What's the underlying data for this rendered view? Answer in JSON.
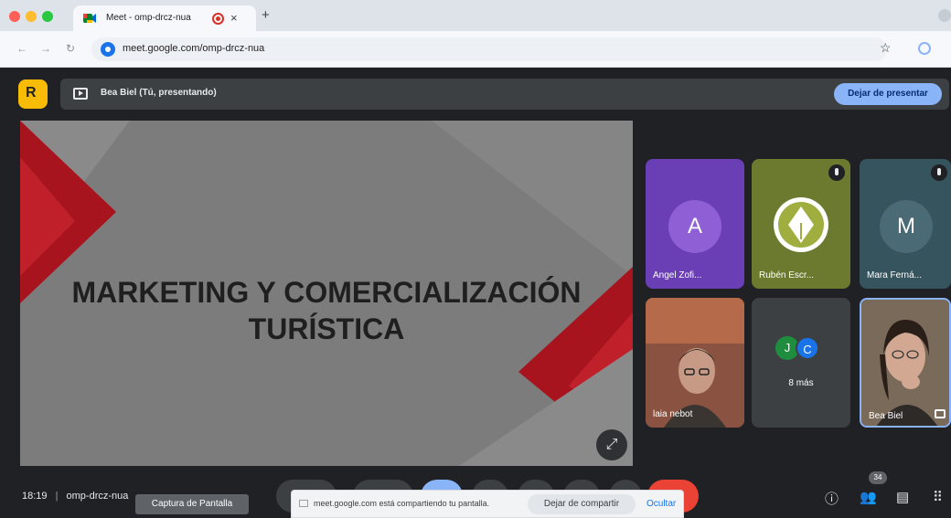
{
  "browser": {
    "tab_title": "Meet - omp-drcz-nua",
    "new_tab_symbol": "+",
    "close_symbol": "×",
    "url": "meet.google.com/omp-drcz-nua"
  },
  "meet": {
    "logo_letter": "R",
    "presenting_label": "Bea Biel (Tú, presentando)",
    "stop_presenting_label": "Dejar de presentar",
    "slide_title_line1": "MARKETING Y COMERCIALIZACIÓN",
    "slide_title_line2": "TURÍSTICA",
    "fullscreen_symbol": "⤢"
  },
  "participants": [
    {
      "name": "Angel Zofi...",
      "initial": "A"
    },
    {
      "name": "Rubén Escr..."
    },
    {
      "name": "Mara Ferná...",
      "initial": "M"
    },
    {
      "name": "laia nebot"
    },
    {
      "name": "8 más",
      "initials": [
        "J",
        "C"
      ]
    },
    {
      "name": "Bea Biel"
    }
  ],
  "bottom_bar": {
    "time": "18:19",
    "separator": "|",
    "meeting_code": "omp-drcz-nua",
    "tooltip": "Captura de Pantalla",
    "people_count": "34"
  },
  "share_banner": {
    "text": "meet.google.com está compartiendo tu pantalla.",
    "stop_label": "Dejar de compartir",
    "hide_label": "Ocultar"
  },
  "colors": {
    "meet_bg": "#202124",
    "accent_blue": "#8ab4f8",
    "slide_red": "#a8141e",
    "hangup_red": "#ea4335",
    "avatar_purple": "#8f5fd6",
    "tile_purple": "#6a3fb5",
    "tile_olive": "#6b7a2e",
    "tile_teal": "#36545e"
  },
  "icons": [
    "present-icon",
    "fullscreen-icon",
    "info-icon",
    "people-icon",
    "chat-icon",
    "activities-icon",
    "star-icon",
    "mic-off-icon"
  ]
}
